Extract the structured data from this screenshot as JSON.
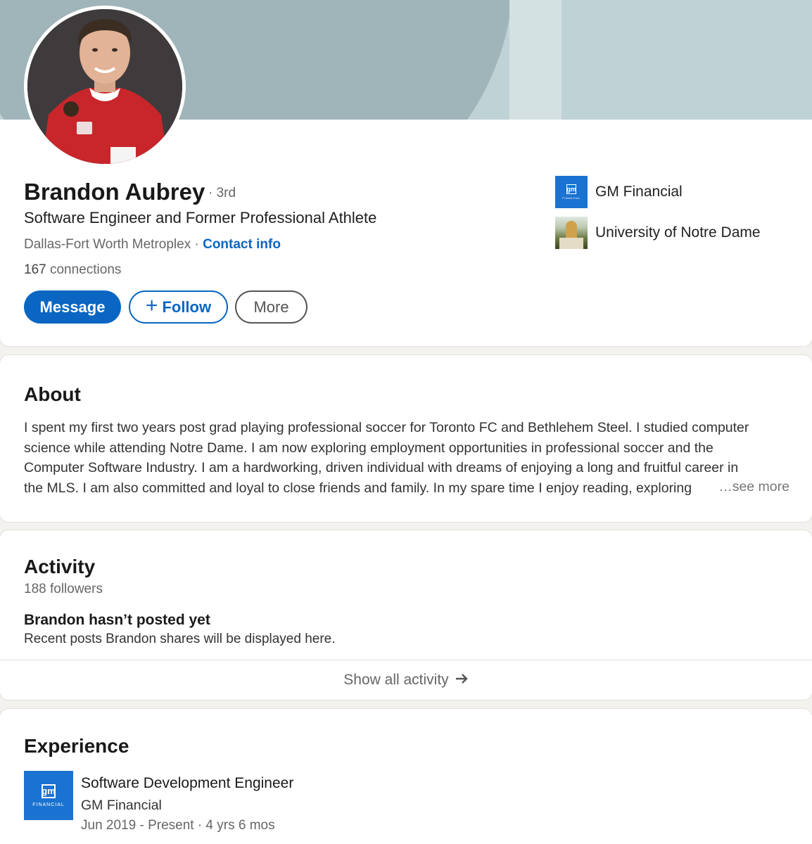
{
  "profile": {
    "name": "Brandon Aubrey",
    "degree": "· 3rd",
    "headline": "Software Engineer and Former Professional Athlete",
    "location": "Dallas-Fort Worth Metroplex · ",
    "contact_info_label": "Contact info",
    "connections_count": "167",
    "connections_label": " connections"
  },
  "actions": {
    "message_label": "Message",
    "follow_label": "Follow",
    "more_label": "More"
  },
  "organizations": [
    {
      "name": "GM Financial",
      "logo_icon": "gm-financial-logo"
    },
    {
      "name": "University of Notre Dame",
      "logo_icon": "notre-dame-logo"
    }
  ],
  "about": {
    "title": "About",
    "lines": [
      "I spent my first two years post grad playing professional soccer for Toronto FC and Bethlehem Steel. I studied computer",
      "science while attending Notre Dame. I am now exploring employment opportunities in professional soccer and the",
      "Computer Software Industry. I am a hardworking, driven individual with dreams of enjoying a long and fruitful career in",
      "the MLS. I am also committed and loyal to close friends and family. In my spare time I enjoy reading, exploring"
    ],
    "see_more_label": "…see more"
  },
  "activity": {
    "title": "Activity",
    "followers": "188 followers",
    "empty_title": "Brandon hasn’t posted yet",
    "empty_subtitle": "Recent posts Brandon shares will be displayed here.",
    "show_all_label": "Show all activity",
    "show_all_icon": "arrow-right-icon"
  },
  "experience": {
    "title": "Experience",
    "items": [
      {
        "title": "Software Development Engineer",
        "company": "GM Financial",
        "dates": "Jun 2019 - Present · 4 yrs 6 mos",
        "logo_icon": "gm-financial-logo"
      }
    ]
  },
  "logos": {
    "gm_mark": "gm",
    "gm_small_caption": "FINANCIAL",
    "gm_caption": "FINANCIAL"
  },
  "colors": {
    "accent": "#0a66c2",
    "banner": "#a0b5b9",
    "gm_blue": "#1a73d0"
  }
}
